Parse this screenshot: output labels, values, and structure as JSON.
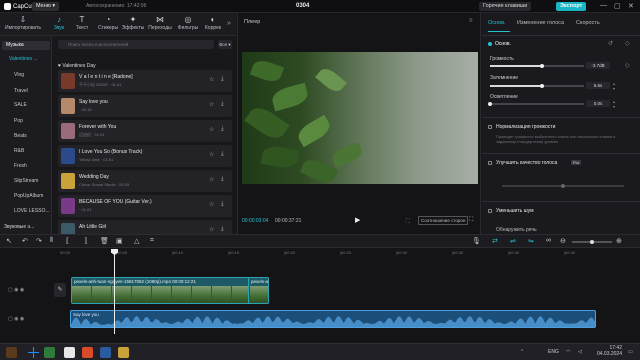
{
  "titlebar": {
    "app_name": "CapCut",
    "menu_label": "Меню ▾",
    "autosave": "Автосохранение: 17:42:06",
    "project_title": "0304",
    "hotkeys_label": "Горячие клавиши",
    "export_label": "Экспорт",
    "win_min": "—",
    "win_max": "▢",
    "win_close": "✕"
  },
  "toolbar": {
    "items": [
      {
        "label": "Импортировать",
        "icon": "⇩",
        "name": "import"
      },
      {
        "label": "Звук",
        "icon": "♪",
        "name": "audio"
      },
      {
        "label": "Текст",
        "icon": "T",
        "name": "text"
      },
      {
        "label": "Стикеры",
        "icon": "◔",
        "name": "stickers"
      },
      {
        "label": "Эффекты",
        "icon": "✦",
        "name": "effects"
      },
      {
        "label": "Переходы",
        "icon": "⋈",
        "name": "transitions"
      },
      {
        "label": "Фильтры",
        "icon": "◎",
        "name": "filters"
      },
      {
        "label": "Коррек",
        "icon": "◐",
        "name": "adjust"
      }
    ],
    "more": "»"
  },
  "categories": {
    "items": [
      "Музыка",
      "Valentines ...",
      "Vlog",
      "Travel",
      "SALE",
      "Pop",
      "Beats",
      "R&B",
      "Fresh",
      "SlipStream",
      "PopUpAlbum",
      "LOVE LESSO..."
    ],
    "effects_label": "Звуковые э..."
  },
  "library": {
    "search_placeholder": "Поиск песен и исполнителей",
    "filter_label": "Все ▾",
    "section_title": "♥ Valentines Day",
    "tracks": [
      {
        "title": "V a l e n t i n e [Radone]",
        "sub": "千千小仙 DGMZ · 01:41",
        "color": "#7a3a2a"
      },
      {
        "title": "Say love you",
        "sub": "· 00:15",
        "color": "#b58a6a"
      },
      {
        "title": "Forever with You",
        "sub": "迈迪纪 · 01:01",
        "color": "#9a6b7a"
      },
      {
        "title": "I Love You So (Bonus Track)",
        "sub": "Yellow Zebr · 01:01",
        "color": "#2a4a8a"
      },
      {
        "title": "Wedding Day",
        "sub": "Chicor Sound Studio · 00:39",
        "color": "#c9a23a"
      },
      {
        "title": "BECAUSE OF YOU (Guitar Ver.)",
        "sub": "· 01:01",
        "color": "#7a3a8a"
      },
      {
        "title": "Ah Little Girl",
        "sub": "",
        "color": "#3a5a6a"
      }
    ]
  },
  "player": {
    "title": "Плеер",
    "time_current": "00:00:03:04",
    "time_total": "00:00:37:21",
    "ratio_label": "Соотношение сторон",
    "menu_icon": "≡",
    "play_icon": "▶",
    "fit_icon": "⛶",
    "full_icon": "⛶"
  },
  "props": {
    "tabs": [
      "Основ.",
      "Изменение голоса",
      "Скорость"
    ],
    "basic_label": "Основ.",
    "volume_label": "Громкость",
    "volume_value": "-3.7dB",
    "volume_level": 0.55,
    "fadein_label": "Затемнение",
    "fadein_value": "5.6s",
    "fadein_level": 0.55,
    "fadeout_label": "Осветление",
    "fadeout_value": "0.0s",
    "fadeout_level": 0.0,
    "normalize_label": "Нормализация громкости",
    "normalize_desc": "Приводит громкость выбранного клипа или нескольких клипов к заданному стандартному уровню",
    "enhance_label": "Улучшить качество голоса",
    "enhance_badge": "Pro",
    "denoise_label": "Уменьшить шум",
    "next_label": "Обнаружить речь"
  },
  "timeline": {
    "ruler": [
      "00:00",
      "|00:05",
      "|00:10",
      "|00:15",
      "|00:20",
      "|00:25",
      "|00:30",
      "|00:35",
      "|00:40",
      "|00:45"
    ],
    "video_clip_title": "pexels-anh-tuan-nguyen-15817062 (1080p).mp4  00:00:12:21",
    "video_clip2_title": "pexels-a",
    "audio_clip_title": "Say love you",
    "video_frame_count": 9,
    "cover_label": "Обложка"
  },
  "taskbar": {
    "lang": "ENG",
    "time": "17:42",
    "date": "04.03.2024"
  }
}
